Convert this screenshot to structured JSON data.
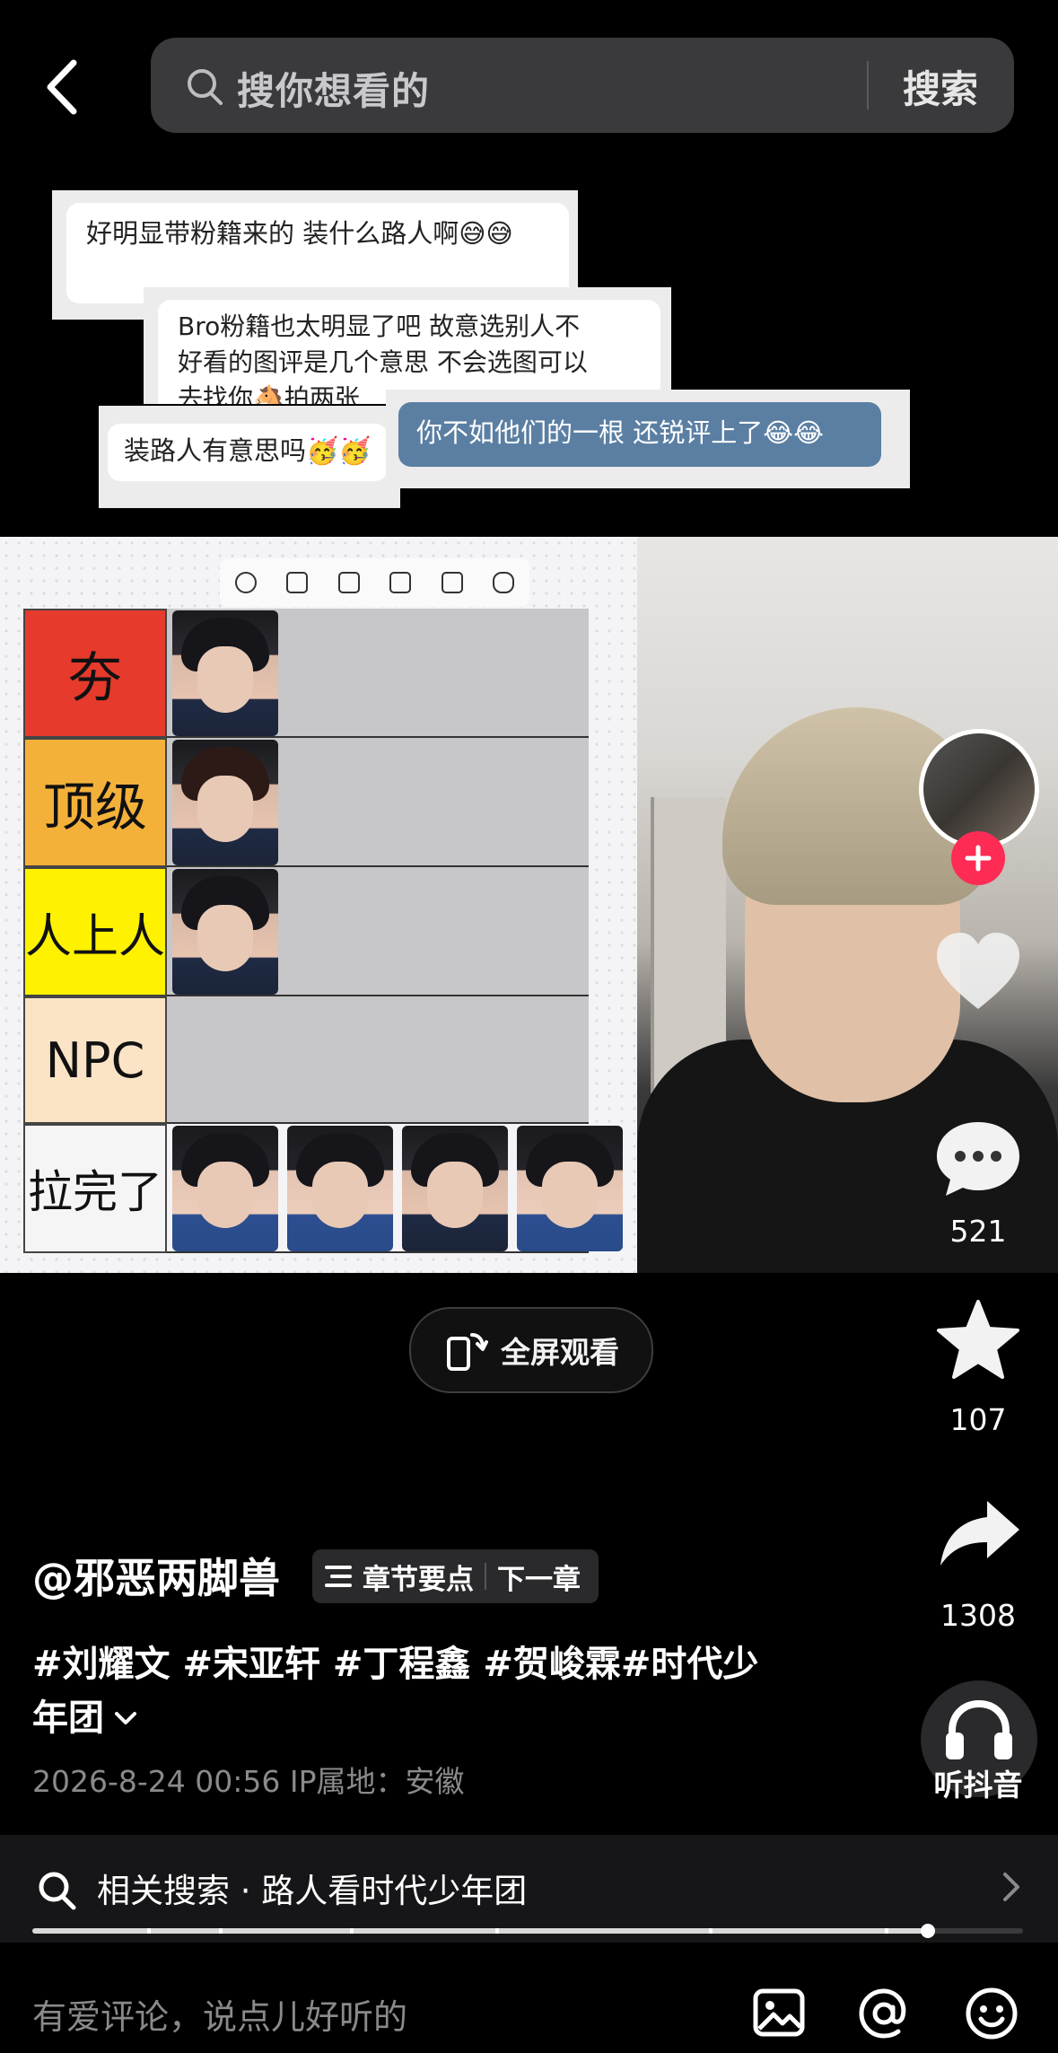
{
  "search": {
    "placeholder": "搜你想看的",
    "button_label": "搜索"
  },
  "comment_collage": {
    "comment1": "好明显带粉籍来的 装什么路人啊😅😅",
    "comment2_lines": [
      "Bro粉籍也太明显了吧 故意选别人不",
      "好看的图评是几个意思 不会选图可以",
      "去找你🐴拍两张"
    ],
    "comment3": "装路人有意思吗🥳🥳",
    "comment4": "你不如他们的一根 还锐评上了😂😂"
  },
  "tier_list": {
    "tiers": [
      "夯",
      "顶级",
      "人上人",
      "NPC",
      "拉完了"
    ],
    "tier_colors": [
      "#e53a2c",
      "#f4b13a",
      "#fff200",
      "#fbe4c6",
      "#f5f5f5"
    ]
  },
  "actions": {
    "like_count": "",
    "comment_count": "521",
    "favorite_count": "107",
    "share_count": "1308",
    "listen_label": "听抖音"
  },
  "fullscreen": {
    "label": "全屏观看"
  },
  "post": {
    "author": "@邪恶两脚兽",
    "chapter_label": "章节要点",
    "next_chapter_label": "下一章",
    "hashtags_line1": "#刘耀文 #宋亚轩 #丁程鑫 #贺峻霖#时代少",
    "hashtags_line2": "年团",
    "meta": "2026-8-24 00:56  IP属地：安徽"
  },
  "related": {
    "text": "相关搜索 · 路人看时代少年团",
    "progress": 0.904
  },
  "comment_bar": {
    "placeholder": "有爱评论，说点儿好听的"
  },
  "colors": {
    "accent": "#fe2c55",
    "background": "#000000"
  }
}
